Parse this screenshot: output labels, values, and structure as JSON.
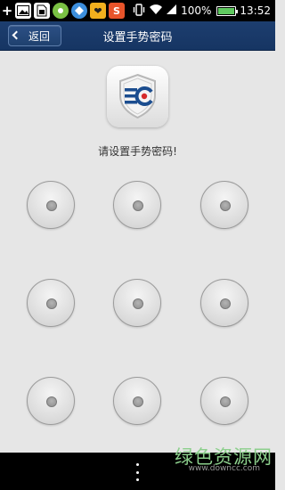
{
  "status_bar": {
    "icons": [
      "plus-icon",
      "photo-icon",
      "sim-icon",
      "app-green-icon",
      "app-blue-icon",
      "app-yellow-icon",
      "app-red-icon",
      "vibrate-icon",
      "wifi-icon",
      "signal-icon",
      "battery-icon"
    ],
    "battery_percent": "100%",
    "time": "13:52",
    "app_yellow_glyph": "❤",
    "app_red_glyph": "S"
  },
  "header": {
    "back_label": "返回",
    "title": "设置手势密码"
  },
  "logo": {
    "icon": "ec-shield-icon",
    "accent_blue": "#1b4d8f",
    "accent_red": "#d62b2b"
  },
  "prompt": "请设置手势密码!",
  "gesture_grid": {
    "rows": 3,
    "cols": 3,
    "nodes": [
      1,
      2,
      3,
      4,
      5,
      6,
      7,
      8,
      9
    ]
  },
  "watermark": {
    "main": "绿色资源网",
    "sub": "www.downcc.com"
  },
  "nav": {
    "menu_icon": "more-vertical-icon"
  }
}
